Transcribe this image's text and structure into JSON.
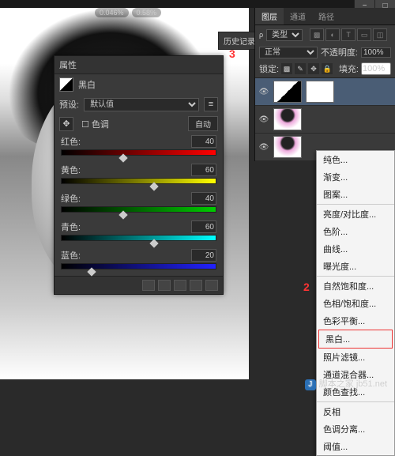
{
  "stats": {
    "a": "0.046%",
    "b": "0.58%"
  },
  "history_label": "历史记录",
  "annotations": {
    "three": "3",
    "two": "2"
  },
  "properties": {
    "tab": "属性",
    "title": "黑白",
    "preset_label": "预设:",
    "preset_value": "默认值",
    "tint_label": "色调",
    "auto_btn": "自动",
    "sliders": [
      {
        "label": "红色:",
        "value": "40",
        "grad": "r",
        "pos": 40
      },
      {
        "label": "黄色:",
        "value": "60",
        "grad": "y",
        "pos": 60
      },
      {
        "label": "绿色:",
        "value": "40",
        "grad": "g",
        "pos": 40
      },
      {
        "label": "青色:",
        "value": "60",
        "grad": "c",
        "pos": 60
      },
      {
        "label": "蓝色:",
        "value": "20",
        "grad": "b",
        "pos": 20
      }
    ]
  },
  "layers": {
    "tabs": [
      "图层",
      "通道",
      "路径"
    ],
    "kind_label": "类型",
    "blend": "正常",
    "opacity_label": "不透明度:",
    "opacity_value": "100%",
    "lock_label": "锁定:",
    "fill_label": "填充:",
    "fill_value": "100%"
  },
  "menu": {
    "items1": [
      "纯色...",
      "渐变...",
      "图案..."
    ],
    "items2": [
      "亮度/对比度...",
      "色阶...",
      "曲线...",
      "曝光度..."
    ],
    "items3": [
      "自然饱和度...",
      "色相/饱和度...",
      "色彩平衡..."
    ],
    "highlight": "黑白...",
    "items4": [
      "照片滤镜...",
      "通道混合器...",
      "颜色查找..."
    ],
    "items5": [
      "反相",
      "色调分离...",
      "阈值..."
    ]
  },
  "watermark": "脚本之家 jb51.net"
}
